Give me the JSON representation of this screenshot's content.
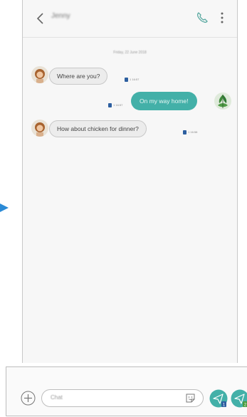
{
  "header": {
    "contact_name": "Jenny",
    "back_icon": "chevron-left-icon",
    "call_icon": "phone-icon",
    "more_icon": "more-vertical-icon"
  },
  "conversation": {
    "date": "Friday, 22 June 2018",
    "messages": [
      {
        "direction": "incoming",
        "text": "Where are you?",
        "sim": "1",
        "time": "16:57"
      },
      {
        "direction": "outgoing",
        "text": "On my way home!",
        "sim": "1",
        "time": "16:57"
      },
      {
        "direction": "incoming",
        "text": "How about chicken for dinner?",
        "sim": "1",
        "time": "16:58"
      }
    ]
  },
  "composer": {
    "add_icon": "plus-icon",
    "placeholder": "Chat",
    "sticker_icon": "sticker-icon",
    "send_sim1_icon": "send-sim1-icon",
    "send_sim1_badge": "1",
    "send_sim2_icon": "send-sim2-icon",
    "send_sim2_badge": "2"
  },
  "colors": {
    "accent": "#43b0a8",
    "outgoing_bubble": "#43b0a8",
    "incoming_bubble": "#ececec",
    "send_button": "#43b0a8",
    "callout_arrow": "#2a8ad6",
    "sim_badge": "#2d5fa0"
  }
}
